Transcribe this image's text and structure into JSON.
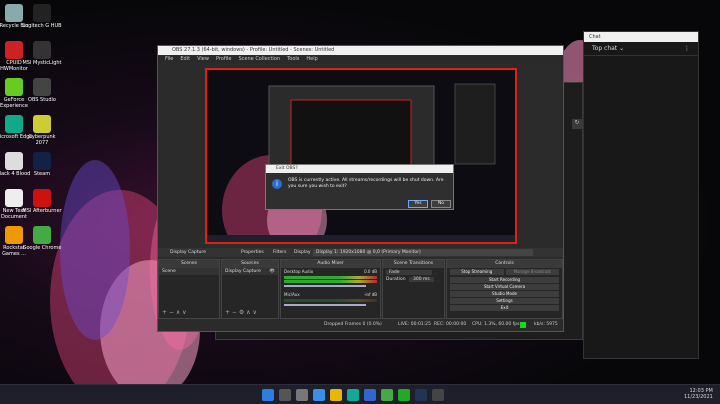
{
  "desktop_icons": [
    {
      "label": "Recycle Bin",
      "color": "#8aa"
    },
    {
      "label": "Logitech G HUB",
      "color": "#222"
    },
    {
      "label": "CPUID HWMonitor",
      "color": "#c22"
    },
    {
      "label": "MSI MysticLight",
      "color": "#333"
    },
    {
      "label": "GeForce Experience",
      "color": "#6c2"
    },
    {
      "label": "OBS Studio",
      "color": "#444"
    },
    {
      "label": "Microsoft Edge",
      "color": "#1a8"
    },
    {
      "label": "Cyberpunk 2077",
      "color": "#cc3"
    },
    {
      "label": "Back 4 Blood",
      "color": "#ddd"
    },
    {
      "label": "Steam",
      "color": "#124"
    },
    {
      "label": "New Text Document",
      "color": "#eee"
    },
    {
      "label": "MSI Afterburner",
      "color": "#c11"
    },
    {
      "label": "Rockstar Games ...",
      "color": "#e90"
    },
    {
      "label": "Google Chrome",
      "color": "#4a4"
    }
  ],
  "obs": {
    "title": "OBS 27.1.3 (64-bit, windows) - Profile: Untitled - Scenes: Untitled",
    "menu": [
      "File",
      "Edit",
      "View",
      "Profile",
      "Scene Collection",
      "Tools",
      "Help"
    ],
    "source_bar": {
      "source": "Display Capture",
      "properties": "Properties",
      "filters": "Filters",
      "display": "Display",
      "display_value": "Display 1: 1920x1080 @ 0,0 (Primary Monitor)"
    },
    "docks": {
      "scenes": "Scenes",
      "sources": "Sources",
      "mixer": "Audio Mixer",
      "transitions": "Scene Transitions",
      "controls": "Controls"
    },
    "scene_item": "Scene",
    "source_item": "Display Capture",
    "mixer": [
      {
        "name": "Desktop Audio",
        "db": "0.0 dB"
      },
      {
        "name": "Mic/Aux",
        "db": "-inf dB"
      }
    ],
    "transitions": {
      "type": "Fade",
      "duration_label": "Duration",
      "duration_value": "300 ms"
    },
    "controls": [
      "Stop Streaming",
      "Manage Broadcast",
      "Start Recording",
      "Start Virtual Camera",
      "Studio Mode",
      "Settings",
      "Exit"
    ],
    "status": {
      "dropped": "Dropped Frames 0 (0.0%)",
      "live": "LIVE: 00:01:25",
      "rec": "REC: 00:00:00",
      "cpu": "CPU: 1.3%, 60.00 fps",
      "kbps": "kb/s: 5975"
    }
  },
  "dialog": {
    "title": "Exit OBS?",
    "message": "OBS is currently active. All streams/recordings will be shut down. Are you sure you wish to exit?",
    "yes": "Yes",
    "no": "No"
  },
  "chat": {
    "title": "Chat",
    "header": "Top chat"
  },
  "taskbar": {
    "time": "12:03 PM",
    "date": "11/23/2021"
  }
}
